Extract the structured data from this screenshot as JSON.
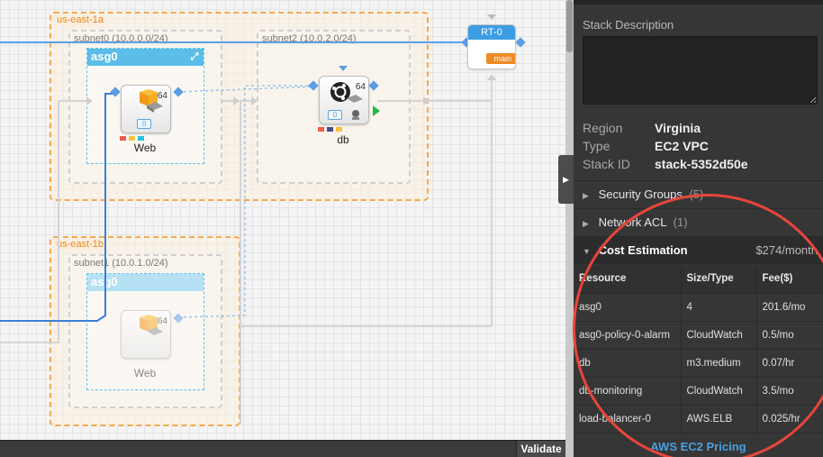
{
  "canvas": {
    "zones": [
      {
        "label": "us-east-1a"
      },
      {
        "label": "us-east-1b"
      }
    ],
    "subnets": [
      {
        "label": "subnet0 (10.0.0.0/24)"
      },
      {
        "label": "subnet2 (10.0.2.0/24)"
      },
      {
        "label": "subnet1 (10.0.1.0/24)"
      }
    ],
    "asg_main": {
      "label": "asg0"
    },
    "asg_ghost": {
      "label": "asg0"
    },
    "web": {
      "label": "Web",
      "count": "64",
      "icon": "package-cube-icon"
    },
    "web_ghost": {
      "label": "Web",
      "count": "64",
      "icon": "package-cube-icon"
    },
    "db": {
      "label": "db",
      "count": "64",
      "icon": "ubuntu-icon"
    },
    "route_table": {
      "label": "RT-0",
      "badge": "main"
    },
    "ebs_glyph": "0",
    "colors": {
      "accent": "#3d9de3",
      "zone": "#f5a94e",
      "sg": [
        "#f05a4a",
        "#f5c33b",
        "#29c1e0",
        "#4a4a8c"
      ],
      "link": "#4a9fe0",
      "highlight": "#e8453c"
    }
  },
  "bottombar": {
    "validate_label": "Validate"
  },
  "panel": {
    "desc_label": "Stack Description",
    "props": [
      {
        "key": "Region",
        "value": "Virginia"
      },
      {
        "key": "Type",
        "value": "EC2 VPC"
      },
      {
        "key": "Stack ID",
        "value": "stack-5352d50e"
      }
    ],
    "sections": [
      {
        "title": "Security Groups",
        "count": "(5)"
      },
      {
        "title": "Network ACL",
        "count": "(1)"
      }
    ],
    "cost": {
      "title": "Cost Estimation",
      "total": "$274/month",
      "headers": [
        "Resource",
        "Size/Type",
        "Fee($)"
      ],
      "rows": [
        [
          "asg0",
          "4",
          "201.6/mo"
        ],
        [
          "asg0-policy-0-alarm",
          "CloudWatch",
          "0.5/mo"
        ],
        [
          "db",
          "m3.medium",
          "0.07/hr"
        ],
        [
          "db-monitoring",
          "CloudWatch",
          "3.5/mo"
        ],
        [
          "load-balancer-0",
          "AWS.ELB",
          "0.025/hr"
        ]
      ]
    },
    "pricing_link": "AWS EC2 Pricing"
  }
}
